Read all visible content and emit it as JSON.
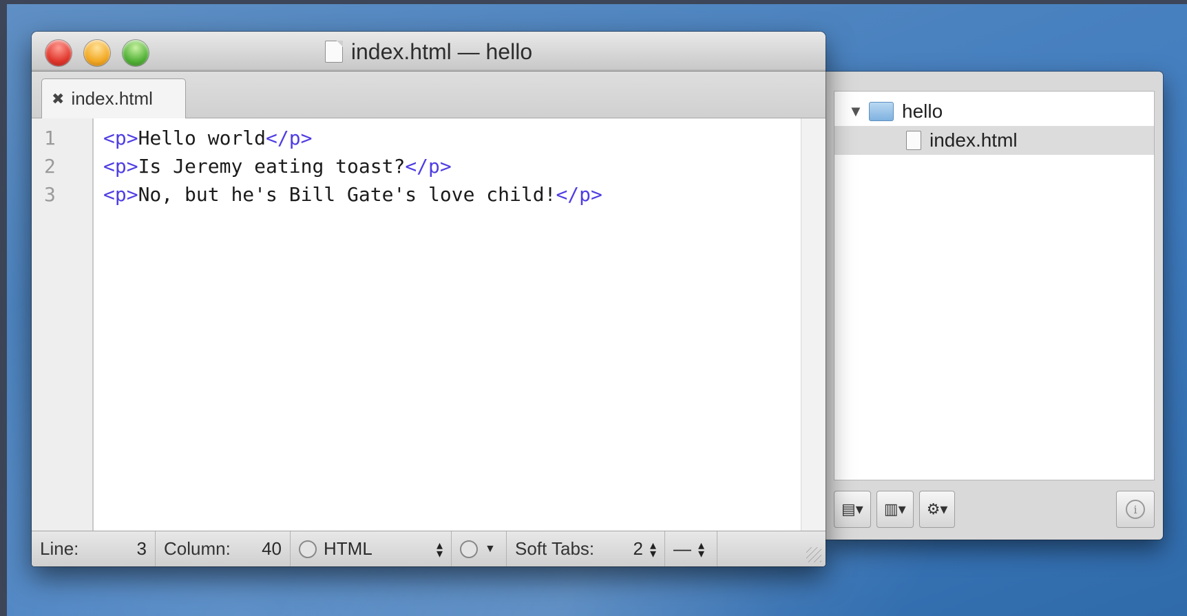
{
  "window": {
    "title": "index.html — hello",
    "tab_close": "✖",
    "tab_label": "index.html"
  },
  "editor": {
    "line_numbers": [
      "1",
      "2",
      "3"
    ],
    "lines": [
      {
        "open_tag": "<p>",
        "text": "Hello world",
        "close_tag": "</p>"
      },
      {
        "open_tag": "<p>",
        "text": "Is Jeremy eating toast?",
        "close_tag": "</p>"
      },
      {
        "open_tag": "<p>",
        "text": "No, but he's Bill Gate's love child!",
        "close_tag": "</p>"
      }
    ]
  },
  "statusbar": {
    "line_label": "Line:",
    "line_value": "3",
    "column_label": "Column:",
    "column_value": "40",
    "language": "HTML",
    "soft_tabs_label": "Soft Tabs:",
    "soft_tabs_value": "2",
    "symbol_value": "—"
  },
  "project": {
    "folder_name": "hello",
    "files": [
      "index.html"
    ],
    "disclosure": "▼"
  },
  "drawer_toolbar": {
    "new_file_glyph": "▤▾",
    "new_folder_glyph": "▥▾",
    "action_glyph": "⚙▾",
    "info_glyph": "i"
  }
}
